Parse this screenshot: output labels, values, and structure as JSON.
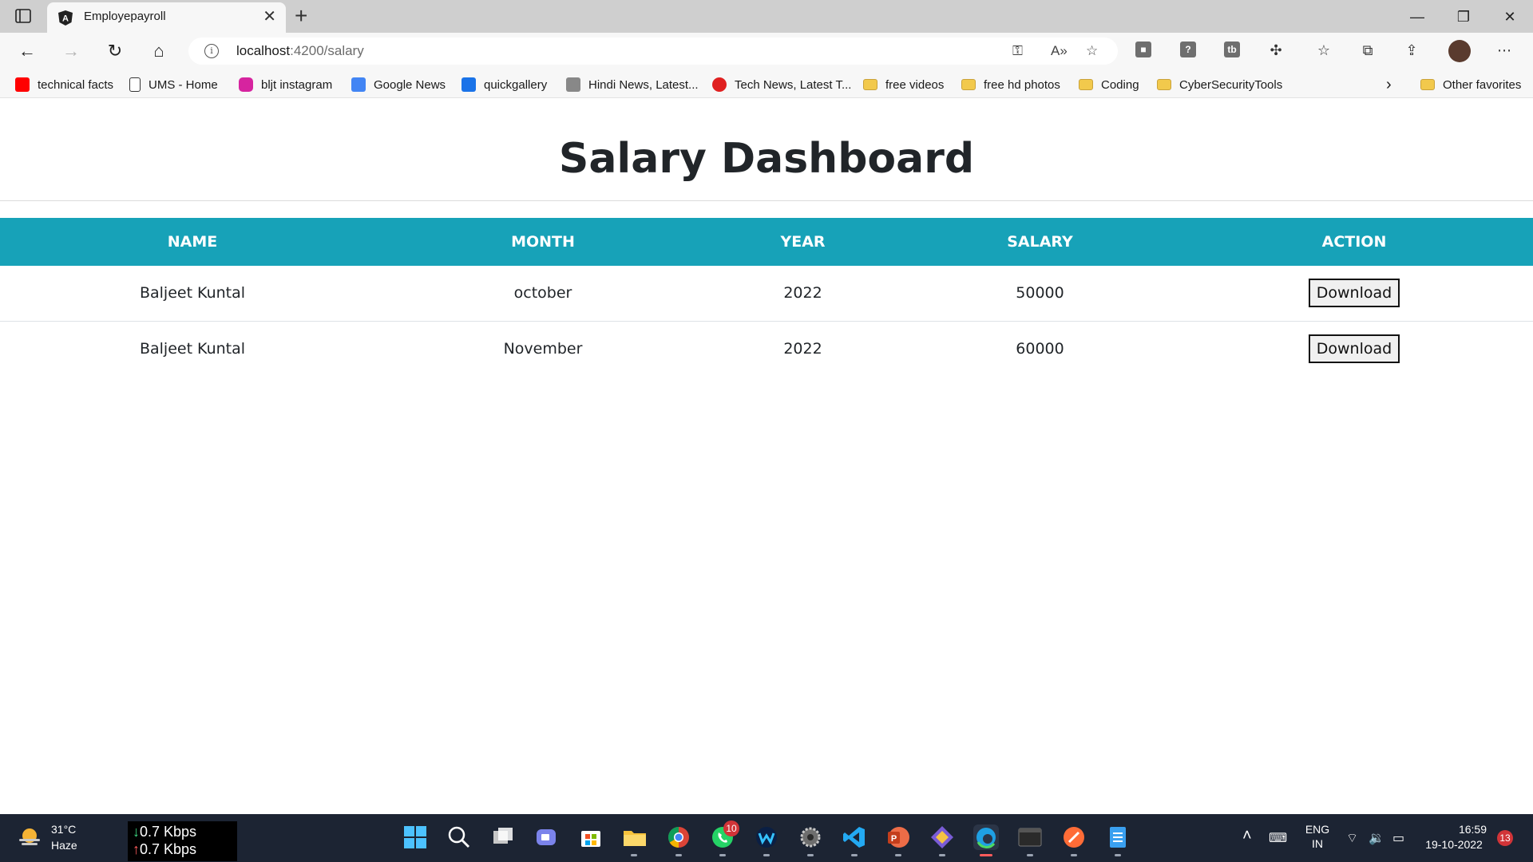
{
  "browser": {
    "tab_title": "Employepayroll",
    "url_host": "localhost",
    "url_path": ":4200/salary",
    "favorites": [
      {
        "label": "technical facts",
        "icon": "youtube-icon",
        "color": "#ff0000"
      },
      {
        "label": "UMS - Home",
        "icon": "page-icon",
        "color": "#ffffff"
      },
      {
        "label": "bljt instagram",
        "icon": "instagram-icon",
        "color": "#d6249f"
      },
      {
        "label": "Google News",
        "icon": "google-news-icon",
        "color": "#4285f4"
      },
      {
        "label": "quickgallery",
        "icon": "camera-icon",
        "color": "#1a73e8"
      },
      {
        "label": "Hindi News, Latest...",
        "icon": "news-icon",
        "color": "#888888"
      },
      {
        "label": "Tech News, Latest T...",
        "icon": "gadgets360-icon",
        "color": "#e02020"
      },
      {
        "label": "free videos",
        "icon": "folder-icon",
        "color": "#f2c94c"
      },
      {
        "label": "free hd photos",
        "icon": "folder-icon",
        "color": "#f2c94c"
      },
      {
        "label": "Coding",
        "icon": "folder-icon",
        "color": "#f2c94c"
      },
      {
        "label": "CyberSecurityTools",
        "icon": "folder-icon",
        "color": "#f2c94c"
      }
    ],
    "other_favorites": "Other favorites"
  },
  "page": {
    "title": "Salary Dashboard",
    "columns": [
      "NAME",
      "MONTH",
      "YEAR",
      "SALARY",
      "ACTION"
    ],
    "rows": [
      {
        "name": "Baljeet Kuntal",
        "month": "october",
        "year": "2022",
        "salary": "50000",
        "action": "Download"
      },
      {
        "name": "Baljeet Kuntal",
        "month": "November",
        "year": "2022",
        "salary": "60000",
        "action": "Download"
      }
    ],
    "header_color": "#17a2b8"
  },
  "taskbar": {
    "weather_temp": "31°C",
    "weather_desc": "Haze",
    "net_down": "0.7 Kbps",
    "net_up": "0.7 Kbps",
    "whatsapp_badge": "10",
    "lang_1": "ENG",
    "lang_2": "IN",
    "time": "16:59",
    "date": "19-10-2022",
    "notif_count": "13"
  }
}
